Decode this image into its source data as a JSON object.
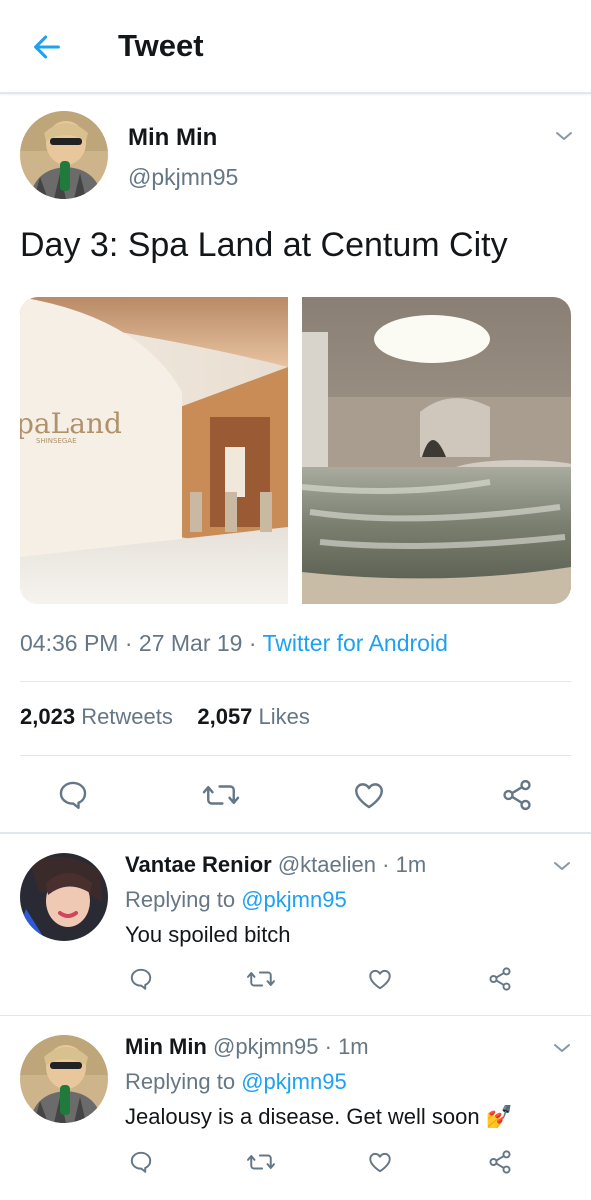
{
  "header": {
    "title": "Tweet",
    "back_icon": "arrow-left-icon"
  },
  "tweet": {
    "author_name": "Min Min",
    "author_handle": "@pkjmn95",
    "text": "Day 3: Spa Land at Centum City",
    "time": "04:36 PM",
    "date": "27 Mar 19",
    "source": "Twitter for Android",
    "retweets_count": "2,023",
    "retweets_label": "Retweets",
    "likes_count": "2,057",
    "likes_label": "Likes",
    "media_sign_text": "paLand",
    "media_sign_sub": "SHINSEGAE"
  },
  "replies": [
    {
      "name": "Vantae Renior",
      "handle": "@ktaelien",
      "time": "1m",
      "replying_label": "Replying to",
      "replying_to": "@pkjmn95",
      "text": "You spoiled bitch"
    },
    {
      "name": "Min Min",
      "handle": "@pkjmn95",
      "time": "1m",
      "replying_label": "Replying to",
      "replying_to": "@pkjmn95",
      "text": "Jealousy is a disease. Get well soon",
      "emoji": "💅"
    }
  ],
  "colors": {
    "accent": "#1da1f2",
    "secondary_text": "#657786",
    "divider": "#e1e8ed"
  }
}
